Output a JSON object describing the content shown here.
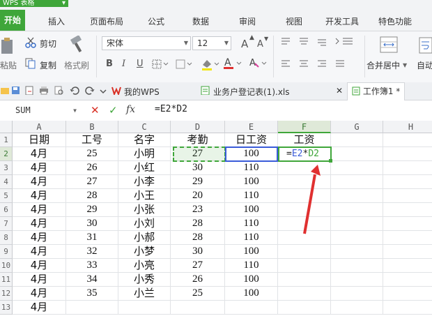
{
  "app": {
    "badge": "WPS 表格",
    "caret": "▾"
  },
  "ribbon_tabs": [
    "开始",
    "插入",
    "页面布局",
    "公式",
    "数据",
    "审阅",
    "视图",
    "开发工具",
    "特色功能"
  ],
  "ribbon": {
    "cut": "剪切",
    "copy": "复制",
    "paste_fragment": "粘贴",
    "format_painter": "格式刷",
    "font_name": "宋体",
    "font_size": "12",
    "font_grow": "A",
    "font_shrink": "A",
    "bold": "B",
    "italic": "I",
    "underline": "U",
    "merge_center": "合并居中",
    "auto_wrap_fragment": "自动"
  },
  "doc_tabs": {
    "mywps": "我的WPS",
    "file1": "业务户登记表(1).xls",
    "file2": "工作簿1 *",
    "close": "✕"
  },
  "formula_bar": {
    "name_box": "SUM",
    "cancel": "✕",
    "confirm": "✓",
    "fx": "fx",
    "formula": "=E2*D2"
  },
  "sheet": {
    "columns": [
      "A",
      "B",
      "C",
      "D",
      "E",
      "F",
      "G",
      "H"
    ],
    "selected_column": "F",
    "rows": [
      [
        "日期",
        "工号",
        "名字",
        "考勤",
        "日工资",
        "工资"
      ],
      [
        "4月",
        "25",
        "小明",
        "27",
        "100",
        ""
      ],
      [
        "4月",
        "26",
        "小红",
        "30",
        "110",
        ""
      ],
      [
        "4月",
        "27",
        "小李",
        "29",
        "100",
        ""
      ],
      [
        "4月",
        "28",
        "小王",
        "20",
        "110",
        ""
      ],
      [
        "4月",
        "29",
        "小张",
        "23",
        "100",
        ""
      ],
      [
        "4月",
        "30",
        "小刘",
        "28",
        "110",
        ""
      ],
      [
        "4月",
        "31",
        "小郝",
        "28",
        "110",
        ""
      ],
      [
        "4月",
        "32",
        "小梦",
        "30",
        "100",
        ""
      ],
      [
        "4月",
        "33",
        "小亮",
        "27",
        "110",
        ""
      ],
      [
        "4月",
        "34",
        "小秀",
        "26",
        "100",
        ""
      ],
      [
        "4月",
        "35",
        "小兰",
        "25",
        "100",
        ""
      ],
      [
        "4月",
        "",
        "",
        "",
        "",
        ""
      ]
    ],
    "row_numbers": [
      "1",
      "2",
      "3",
      "4",
      "5",
      "6",
      "7",
      "8",
      "9",
      "10",
      "11",
      "12",
      "13"
    ],
    "editing_cell": {
      "eq": "=",
      "ref1": "E2",
      "op": "*",
      "ref2": "D2"
    }
  },
  "colors": {
    "accent": "#3fa63a",
    "ref_blue": "#3a5bd9",
    "arrow": "#e03030"
  }
}
